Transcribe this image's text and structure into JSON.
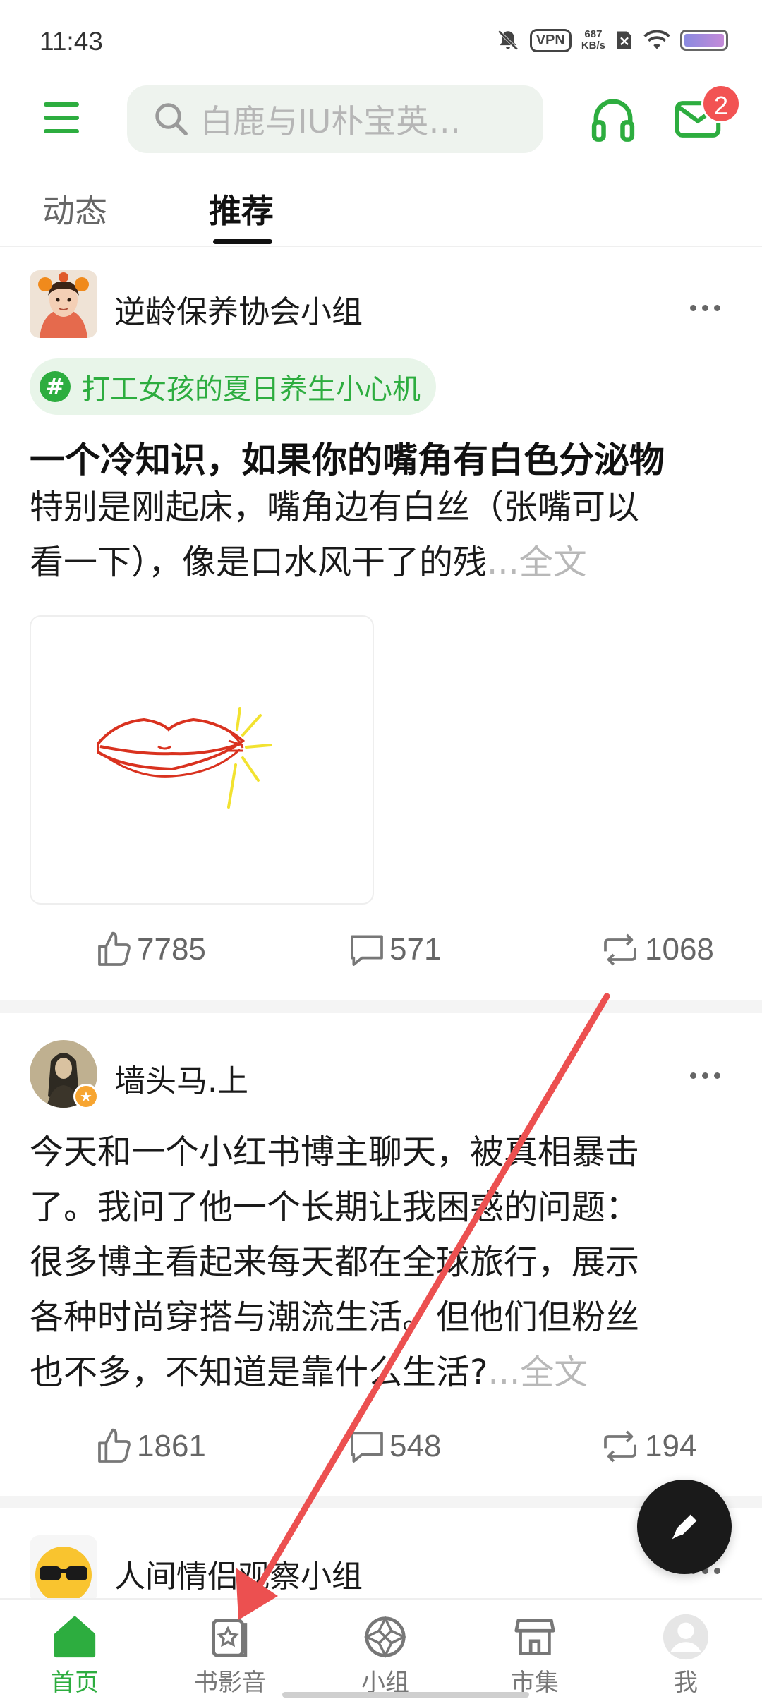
{
  "status_bar": {
    "time": "11:43",
    "vpn": "VPN",
    "speed_value": "687",
    "speed_unit": "KB/s"
  },
  "header": {
    "search_placeholder": "白鹿与IU朴宝英…",
    "unread_count": "2",
    "accent_color": "#2dad3f"
  },
  "tabs": [
    {
      "label": "动态",
      "selected": false
    },
    {
      "label": "推荐",
      "selected": true
    }
  ],
  "posts": [
    {
      "author": "逆龄保养协会小组",
      "topic": "打工女孩的夏日养生小心机",
      "title": "一个冷知识，如果你的嘴角有白色分泌物",
      "body_line1": "特别是刚起床，嘴角边有白丝（张嘴可以",
      "body_line2": "看一下），像是口水风干了的残",
      "ellipsis": "...",
      "fulltext": "全文",
      "likes": "7785",
      "comments": "571",
      "reposts": "1068"
    },
    {
      "author": "墙头马.上",
      "body_lines": [
        "今天和一个小红书博主聊天，被真相暴击",
        "了。我问了他一个长期让我困惑的问题：",
        "很多博主看起来每天都在全球旅行，展示",
        "各种时尚穿搭与潮流生活。但他们但粉丝",
        "也不多，不知道是靠什么生活?"
      ],
      "ellipsis": "...",
      "fulltext": "全文",
      "likes": "1861",
      "comments": "548",
      "reposts": "194"
    },
    {
      "author": "人间情侣观察小组"
    }
  ],
  "bottom_nav": [
    {
      "label": "首页",
      "icon": "home-icon",
      "active": true
    },
    {
      "label": "书影音",
      "icon": "book-movie-music-icon",
      "active": false
    },
    {
      "label": "小组",
      "icon": "group-icon",
      "active": false
    },
    {
      "label": "市集",
      "icon": "market-icon",
      "active": false
    },
    {
      "label": "我",
      "icon": "profile-icon",
      "active": false
    }
  ]
}
